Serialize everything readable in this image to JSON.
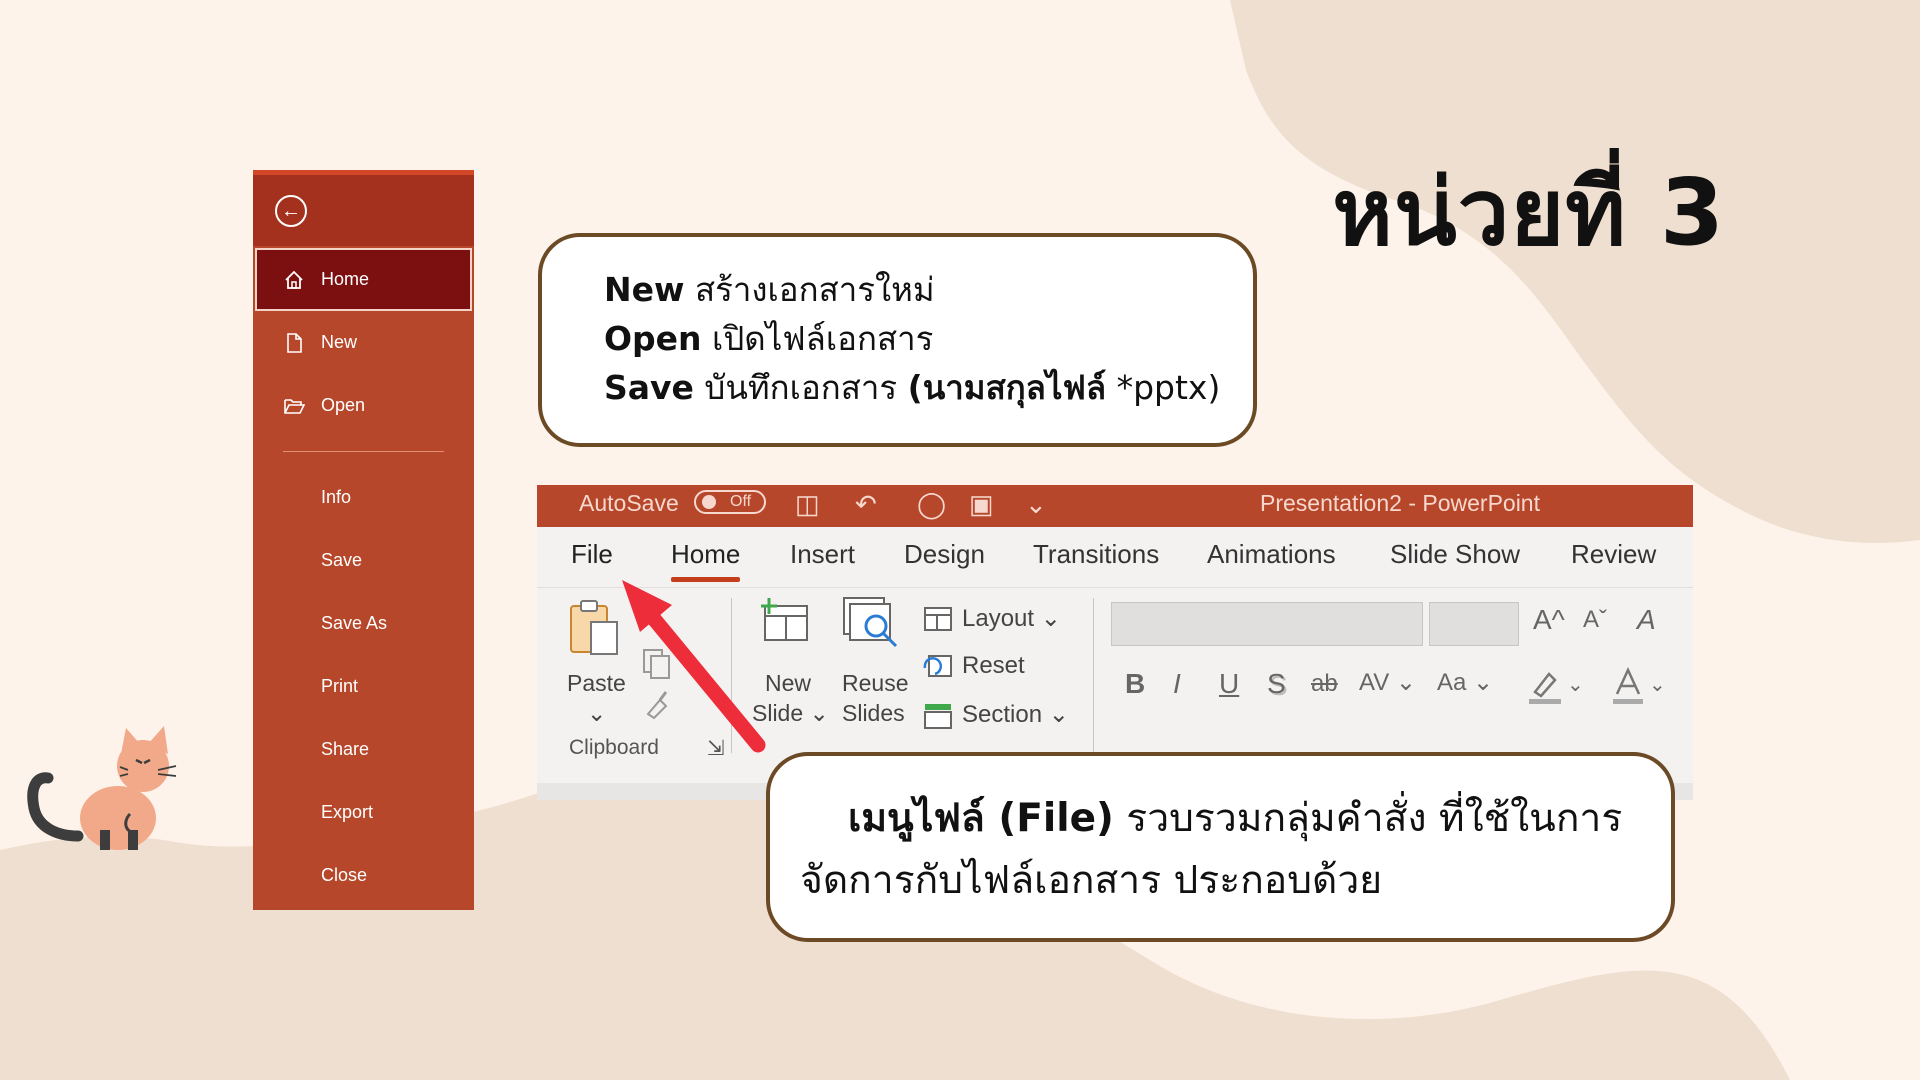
{
  "title": "หน่วยที่ 3",
  "colors": {
    "background": "#fdf3ea",
    "blob": "#efdfd0",
    "file_menu": "#b7472a",
    "file_menu_active": "#7c0f0f",
    "callout_border": "#6b4a25",
    "arrow": "#ee2d3a",
    "ribbon_accent": "#c43e1c"
  },
  "file_menu": {
    "back_icon": "arrow-left-circle-icon",
    "items": [
      {
        "label": "Home",
        "icon": "home-icon",
        "active": true
      },
      {
        "label": "New",
        "icon": "new-document-icon"
      },
      {
        "label": "Open",
        "icon": "folder-open-icon"
      }
    ],
    "items_secondary": [
      {
        "label": "Info"
      },
      {
        "label": "Save"
      },
      {
        "label": "Save As"
      },
      {
        "label": "Print"
      },
      {
        "label": "Share"
      },
      {
        "label": "Export"
      },
      {
        "label": "Close"
      }
    ]
  },
  "callout_top": {
    "lines": [
      {
        "keyword": "New",
        "text": " สร้างเอกสารใหม่"
      },
      {
        "keyword": "Open",
        "text": " เปิดไฟล์เอกสาร"
      },
      {
        "keyword": "Save",
        "text": " บันทึกเอกสาร ",
        "extra_bold": "(นามสกุลไฟล์",
        "extra": " *pptx)"
      }
    ]
  },
  "callout_bottom": {
    "bold": "เมนูไฟล์ (File)",
    "line1_rest": " รวบรวมกลุ่มคำสั่ง ที่ใช้ในการ",
    "line2": "จัดการกับไฟล์เอกสาร ประกอบด้วย"
  },
  "ribbon": {
    "titlebar": {
      "autosave": "AutoSave",
      "toggle": "Off",
      "title": "Presentation2  -  PowerPoint"
    },
    "tabs": [
      "File",
      "Home",
      "Insert",
      "Design",
      "Transitions",
      "Animations",
      "Slide Show",
      "Review"
    ],
    "active_tab": "Home",
    "clipboard": {
      "paste": "Paste",
      "paste_arrow": "⌄",
      "group_label": "Clipboard"
    },
    "slides": {
      "new_slide_1": "New",
      "new_slide_2": "Slide ⌄",
      "reuse_1": "Reuse",
      "reuse_2": "Slides",
      "layout": "Layout ⌄",
      "reset": "Reset",
      "section": "Section ⌄"
    },
    "font": {
      "grow": "A^",
      "shrink": "Aˇ",
      "clear": "A",
      "bold": "B",
      "italic": "I",
      "underline": "U",
      "shadow": "S",
      "strike": "ab",
      "spacing": "AV ⌄",
      "case": "Aa ⌄",
      "highlight_arrow": "⌄",
      "color_arrow": "⌄"
    }
  }
}
